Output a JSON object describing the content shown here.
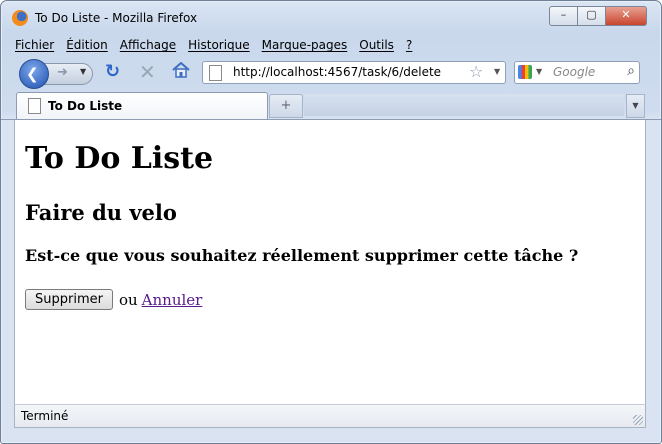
{
  "window": {
    "title": "To Do Liste - Mozilla Firefox",
    "minimize": "–",
    "maximize": "▢",
    "close": "✕"
  },
  "menu": [
    "Fichier",
    "Édition",
    "Affichage",
    "Historique",
    "Marque-pages",
    "Outils",
    "?"
  ],
  "nav": {
    "url": "http://localhost:4567/task/6/delete",
    "search_placeholder": "Google"
  },
  "tab": {
    "title": "To Do Liste",
    "new_tab": "+"
  },
  "page": {
    "heading": "To Do Liste",
    "task_name": "Faire du velo",
    "question": "Est-ce que vous souhaitez réellement supprimer cette tâche ?",
    "delete_button": "Supprimer",
    "or_text": "ou",
    "cancel_link": "Annuler"
  },
  "status": {
    "text": "Terminé"
  }
}
